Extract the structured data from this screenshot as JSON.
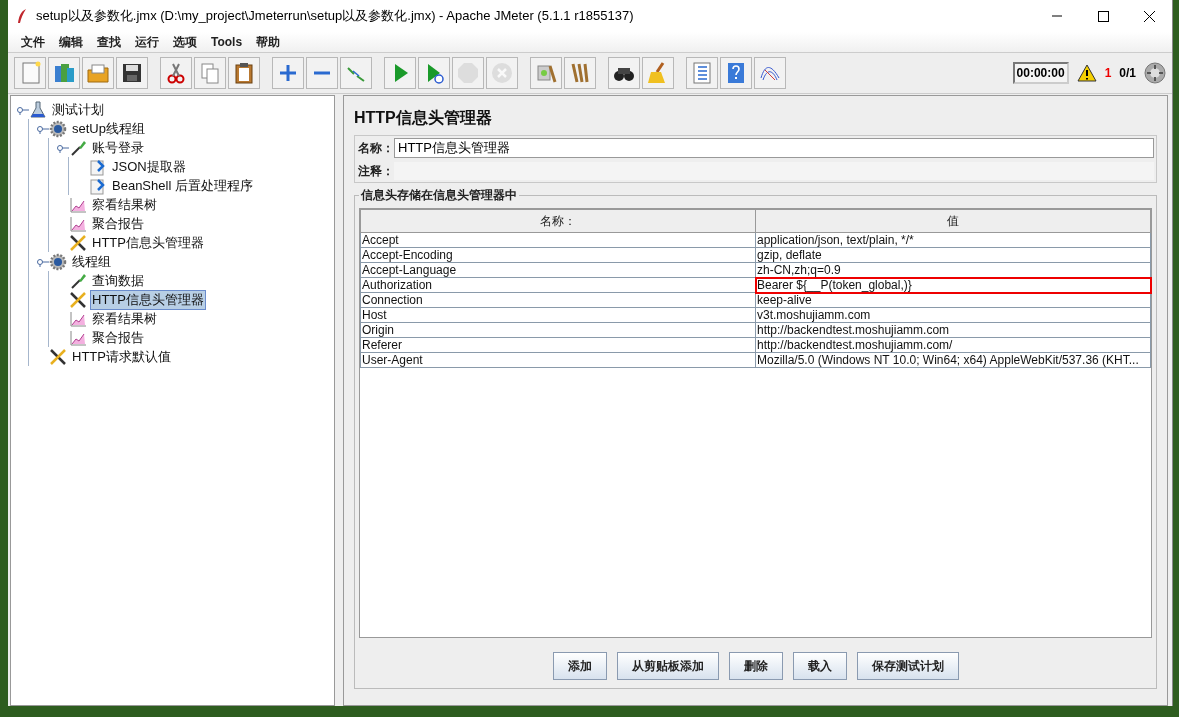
{
  "window": {
    "title": "setup以及参数化.jmx (D:\\my_project\\Jmeterrun\\setup以及参数化.jmx) - Apache JMeter (5.1.1 r1855137)"
  },
  "menu": [
    "文件",
    "编辑",
    "查找",
    "运行",
    "选项",
    "Tools",
    "帮助"
  ],
  "toolbar": [
    {
      "kind": "new",
      "disabled": false
    },
    {
      "kind": "templates",
      "disabled": false
    },
    {
      "kind": "open",
      "disabled": false
    },
    {
      "kind": "save",
      "disabled": false
    },
    {
      "kind": "sep"
    },
    {
      "kind": "cut",
      "disabled": false
    },
    {
      "kind": "copy",
      "disabled": false
    },
    {
      "kind": "paste",
      "disabled": false
    },
    {
      "kind": "sep"
    },
    {
      "kind": "expand",
      "disabled": false
    },
    {
      "kind": "collapse",
      "disabled": false
    },
    {
      "kind": "toggle",
      "disabled": false
    },
    {
      "kind": "sep"
    },
    {
      "kind": "start",
      "disabled": false
    },
    {
      "kind": "start-no-pause",
      "disabled": false
    },
    {
      "kind": "stop",
      "disabled": true
    },
    {
      "kind": "shutdown",
      "disabled": true
    },
    {
      "kind": "sep"
    },
    {
      "kind": "clear",
      "disabled": false
    },
    {
      "kind": "clear-all",
      "disabled": false
    },
    {
      "kind": "sep"
    },
    {
      "kind": "search",
      "disabled": false
    },
    {
      "kind": "reset-search",
      "disabled": false
    },
    {
      "kind": "sep"
    },
    {
      "kind": "function-helper",
      "disabled": false
    },
    {
      "kind": "help",
      "disabled": false
    },
    {
      "kind": "logger",
      "disabled": false
    }
  ],
  "status": {
    "timer": "00:00:00",
    "warnings": "1",
    "threads": "0/1"
  },
  "tree": [
    {
      "label": "测试计划",
      "kind": "test-plan",
      "selected": false,
      "expanded": true,
      "children": [
        {
          "label": "setUp线程组",
          "kind": "thread-group",
          "selected": false,
          "expanded": true,
          "children": [
            {
              "label": "账号登录",
              "kind": "sampler",
              "selected": false,
              "expanded": true,
              "children": [
                {
                  "label": "JSON提取器",
                  "kind": "post-processor",
                  "selected": false
                },
                {
                  "label": "BeanShell 后置处理程序",
                  "kind": "post-processor",
                  "selected": false
                }
              ]
            },
            {
              "label": "察看结果树",
              "kind": "listener",
              "selected": false
            },
            {
              "label": "聚合报告",
              "kind": "listener",
              "selected": false
            },
            {
              "label": "HTTP信息头管理器",
              "kind": "config",
              "selected": false
            }
          ]
        },
        {
          "label": "线程组",
          "kind": "thread-group",
          "selected": false,
          "expanded": true,
          "children": [
            {
              "label": "查询数据",
              "kind": "sampler",
              "selected": false
            },
            {
              "label": "HTTP信息头管理器",
              "kind": "config",
              "selected": true
            },
            {
              "label": "察看结果树",
              "kind": "listener",
              "selected": false
            },
            {
              "label": "聚合报告",
              "kind": "listener",
              "selected": false
            }
          ]
        },
        {
          "label": "HTTP请求默认值",
          "kind": "config",
          "selected": false
        }
      ]
    }
  ],
  "panel": {
    "title": "HTTP信息头管理器",
    "name_label": "名称：",
    "name_value": "HTTP信息头管理器",
    "comment_label": "注释：",
    "group_title": "信息头存储在信息头管理器中",
    "table": {
      "columns": [
        "名称：",
        "值"
      ],
      "rows": [
        {
          "name": "Accept",
          "value": "application/json, text/plain, */*",
          "annotated": false
        },
        {
          "name": "Accept-Encoding",
          "value": "gzip, deflate",
          "annotated": false
        },
        {
          "name": "Accept-Language",
          "value": "zh-CN,zh;q=0.9",
          "annotated": false
        },
        {
          "name": "Authorization",
          "value": "Bearer ${__P(token_global,)}",
          "annotated": true
        },
        {
          "name": "Connection",
          "value": "keep-alive",
          "annotated": false
        },
        {
          "name": "Host",
          "value": "v3t.moshujiamm.com",
          "annotated": false
        },
        {
          "name": "Origin",
          "value": "http://backendtest.moshujiamm.com",
          "annotated": false
        },
        {
          "name": "Referer",
          "value": "http://backendtest.moshujiamm.com/",
          "annotated": false
        },
        {
          "name": "User-Agent",
          "value": "Mozilla/5.0 (Windows NT 10.0; Win64; x64) AppleWebKit/537.36 (KHT...",
          "annotated": false
        }
      ]
    },
    "buttons": [
      "添加",
      "从剪贴板添加",
      "删除",
      "载入",
      "保存测试计划"
    ]
  }
}
